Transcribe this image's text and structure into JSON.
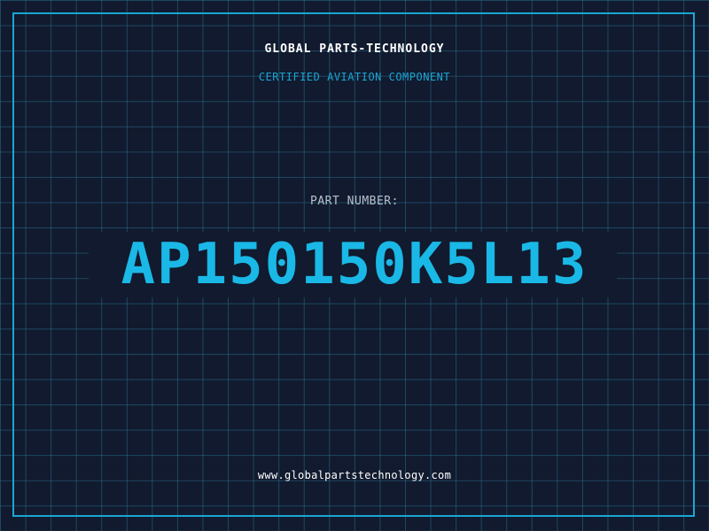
{
  "header": {
    "company_name": "GLOBAL PARTS-TECHNOLOGY",
    "tagline": "CERTIFIED AVIATION COMPONENT"
  },
  "part": {
    "label": "PART NUMBER:",
    "number": "AP150150K5L13"
  },
  "footer": {
    "website": "www.globalpartstechnology.com"
  },
  "colors": {
    "background": "#111a2e",
    "grid": "#286e8c",
    "accent": "#1aa6d4",
    "part_number": "#1ab8e6",
    "label": "#b7c0cc",
    "text": "#ffffff"
  }
}
